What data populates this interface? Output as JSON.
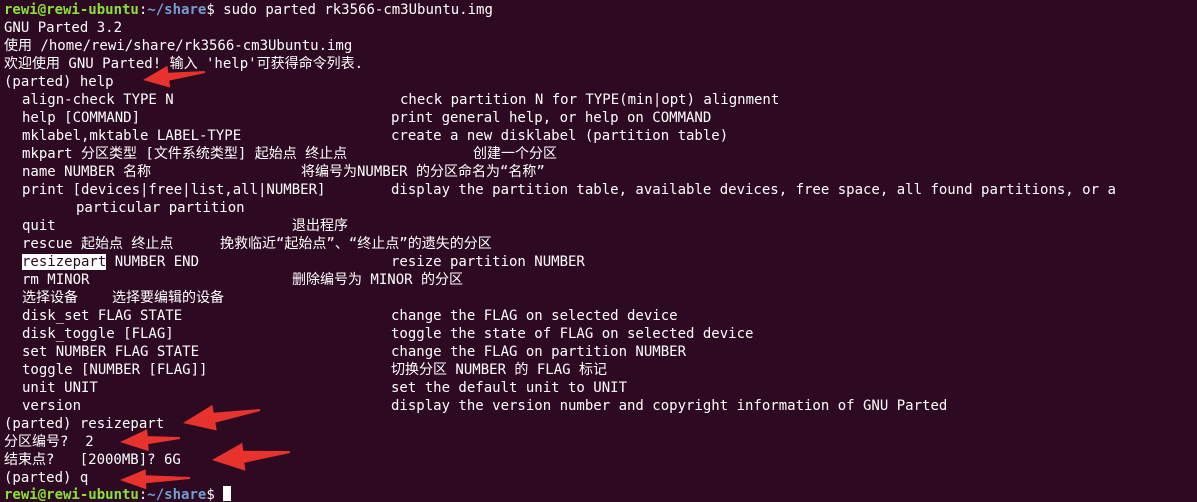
{
  "prompt_user": "rewi@rewi-ubuntu",
  "prompt_path": "~/share",
  "command": "sudo parted rk3566-cm3Ubuntu.img",
  "version_line": "GNU Parted 3.2",
  "using_line": "使用 /home/rewi/share/rk3566-cm3Ubuntu.img",
  "welcome_line": "欢迎使用 GNU Parted! 输入 'help'可获得命令列表.",
  "help_cmd": "(parted) help",
  "help_rows": [
    {
      "cmd": "align-check TYPE N",
      "desc": "check partition N for TYPE(min|opt) alignment"
    },
    {
      "cmd": "help [COMMAND]",
      "desc": "print general help, or help on COMMAND"
    },
    {
      "cmd": "mklabel,mktable LABEL-TYPE",
      "desc": "create a new disklabel (partition table)"
    },
    {
      "cmd": "mkpart 分区类型 [文件系统类型] 起始点 终止点",
      "desc": "创建一个分区"
    },
    {
      "cmd": "name NUMBER 名称",
      "desc": "将编号为NUMBER 的分区命名为“名称”"
    },
    {
      "cmd": "print [devices|free|list,all|NUMBER]",
      "desc": "display the partition table, available devices, free space, all found partitions, or a"
    },
    {
      "cmd": "",
      "desc": "particular partition"
    },
    {
      "cmd": "quit",
      "desc": "退出程序"
    },
    {
      "cmd": "rescue 起始点 终止点",
      "desc": "挽救临近“起始点”、“终止点”的遗失的分区"
    },
    {
      "cmd": "resizepart",
      "cmd_rest": " NUMBER END",
      "desc": "resize partition NUMBER"
    },
    {
      "cmd": "rm MINOR",
      "desc": "删除编号为 MINOR 的分区"
    },
    {
      "cmd": "选择设备",
      "desc": "选择要编辑的设备"
    },
    {
      "cmd": "disk_set FLAG STATE",
      "desc": "change the FLAG on selected device"
    },
    {
      "cmd": "disk_toggle [FLAG]",
      "desc": "toggle the state of FLAG on selected device"
    },
    {
      "cmd": "set NUMBER FLAG STATE",
      "desc": "change the FLAG on partition NUMBER"
    },
    {
      "cmd": "toggle [NUMBER [FLAG]]",
      "desc": "切换分区 NUMBER 的 FLAG 标记"
    },
    {
      "cmd": "unit UNIT",
      "desc": "set the default unit to UNIT"
    },
    {
      "cmd": "version",
      "desc": "display the version number and copyright information of GNU Parted"
    }
  ],
  "resize_cmd": "(parted) resizepart",
  "partition_prompt": "分区编号?  2",
  "end_prompt": "结束点?   [2000MB]? 6G",
  "quit_cmd": "(parted) q",
  "annotation_color": "#e8322d"
}
